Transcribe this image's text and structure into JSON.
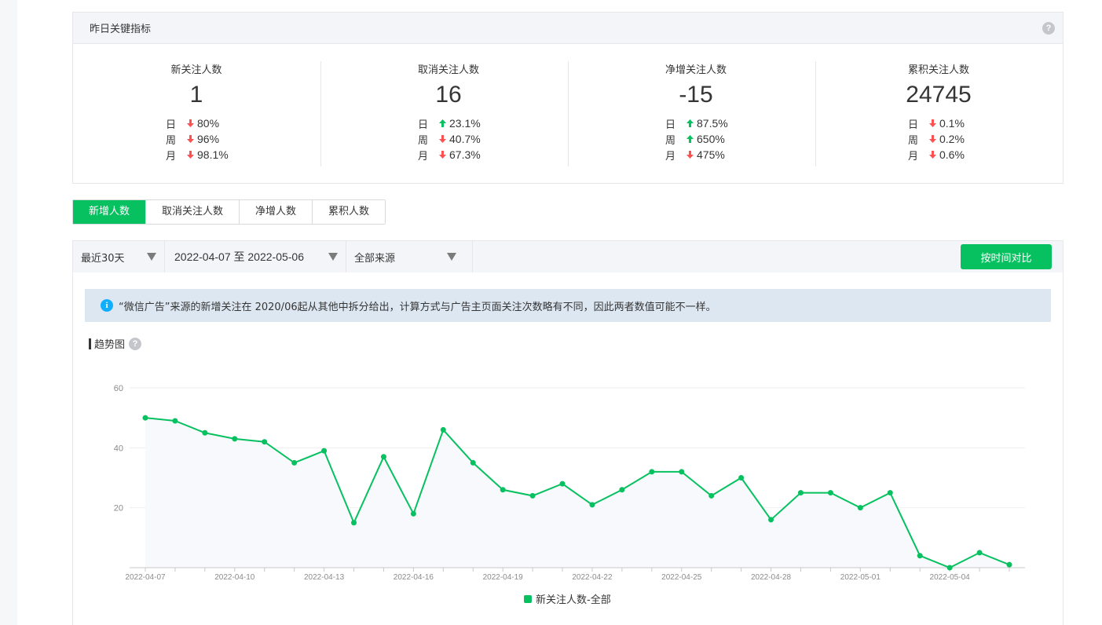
{
  "metrics": {
    "title": "昨日关键指标",
    "help": "?",
    "items": [
      {
        "label": "新关注人数",
        "value": "1",
        "rows": [
          {
            "period": "日",
            "dir": "down",
            "pct": "80%"
          },
          {
            "period": "周",
            "dir": "down",
            "pct": "96%"
          },
          {
            "period": "月",
            "dir": "down",
            "pct": "98.1%"
          }
        ]
      },
      {
        "label": "取消关注人数",
        "value": "16",
        "rows": [
          {
            "period": "日",
            "dir": "up",
            "pct": "23.1%"
          },
          {
            "period": "周",
            "dir": "down",
            "pct": "40.7%"
          },
          {
            "period": "月",
            "dir": "down",
            "pct": "67.3%"
          }
        ]
      },
      {
        "label": "净增关注人数",
        "value": "-15",
        "rows": [
          {
            "period": "日",
            "dir": "up",
            "pct": "87.5%"
          },
          {
            "period": "周",
            "dir": "up",
            "pct": "650%"
          },
          {
            "period": "月",
            "dir": "down",
            "pct": "475%"
          }
        ]
      },
      {
        "label": "累积关注人数",
        "value": "24745",
        "rows": [
          {
            "period": "日",
            "dir": "down",
            "pct": "0.1%"
          },
          {
            "period": "周",
            "dir": "down",
            "pct": "0.2%"
          },
          {
            "period": "月",
            "dir": "down",
            "pct": "0.6%"
          }
        ]
      }
    ]
  },
  "colors": {
    "up": "#07c160",
    "down": "#fa5151",
    "accent": "#07c160"
  },
  "tabs": [
    {
      "label": "新增人数",
      "active": true
    },
    {
      "label": "取消关注人数",
      "active": false
    },
    {
      "label": "净增人数",
      "active": false
    },
    {
      "label": "累积人数",
      "active": false
    }
  ],
  "filters": {
    "range": "最近30天",
    "dates": "2022-04-07 至 2022-05-06",
    "source": "全部来源",
    "compare": "按时间对比"
  },
  "notice": {
    "icon": "i",
    "text": "“微信广告”来源的新增关注在 2020/06起从其他中拆分给出，计算方式与广告主页面关注次数略有不同，因此两者数值可能不一样。"
  },
  "trend": {
    "title": "趋势图",
    "help": "?"
  },
  "chart_data": {
    "type": "line",
    "x": [
      "2022-04-07",
      "2022-04-08",
      "2022-04-09",
      "2022-04-10",
      "2022-04-11",
      "2022-04-12",
      "2022-04-13",
      "2022-04-14",
      "2022-04-15",
      "2022-04-16",
      "2022-04-17",
      "2022-04-18",
      "2022-04-19",
      "2022-04-20",
      "2022-04-21",
      "2022-04-22",
      "2022-04-23",
      "2022-04-24",
      "2022-04-25",
      "2022-04-26",
      "2022-04-27",
      "2022-04-28",
      "2022-04-29",
      "2022-04-30",
      "2022-05-01",
      "2022-05-02",
      "2022-05-03",
      "2022-05-04",
      "2022-05-05",
      "2022-05-06"
    ],
    "tick_labels": [
      "2022-04-07",
      "2022-04-10",
      "2022-04-13",
      "2022-04-16",
      "2022-04-19",
      "2022-04-22",
      "2022-04-25",
      "2022-04-28",
      "2022-05-01",
      "2022-05-04"
    ],
    "series": [
      {
        "name": "新关注人数-全部",
        "values": [
          50,
          49,
          45,
          43,
          42,
          35,
          39,
          15,
          37,
          18,
          46,
          35,
          26,
          24,
          28,
          21,
          26,
          32,
          32,
          24,
          30,
          16,
          25,
          25,
          20,
          25,
          4,
          0,
          5,
          1
        ]
      }
    ],
    "yticks": [
      20,
      40,
      60
    ],
    "ylim": [
      0,
      60
    ],
    "grid": true,
    "legend": "bottom-center",
    "color": "#07c160"
  }
}
